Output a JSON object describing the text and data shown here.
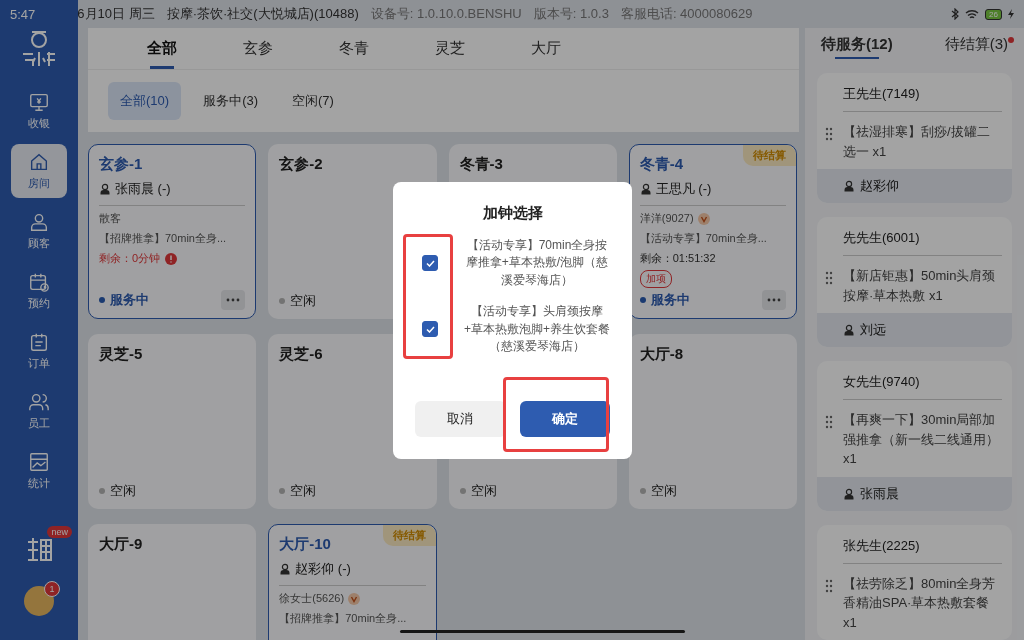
{
  "status_bar": {
    "time": "5:47",
    "date": "6月10日 周三",
    "store": "按摩·茶饮·社交(大悦城店)(10488)",
    "device": "设备号: 1.0.10.0.BENSHU",
    "version": "版本号: 1.0.3",
    "phone": "客服电话: 4000080629",
    "battery": "26"
  },
  "sidebar": {
    "items": [
      {
        "label": "收银",
        "selected": false
      },
      {
        "label": "房间",
        "selected": true
      },
      {
        "label": "顾客",
        "selected": false
      },
      {
        "label": "预约",
        "selected": false
      },
      {
        "label": "订单",
        "selected": false
      },
      {
        "label": "员工",
        "selected": false
      },
      {
        "label": "统计",
        "selected": false
      }
    ],
    "promo_badge": "new",
    "avatar_badge": "1"
  },
  "area_tabs": [
    {
      "label": "全部",
      "selected": true
    },
    {
      "label": "玄参",
      "selected": false
    },
    {
      "label": "冬青",
      "selected": false
    },
    {
      "label": "灵芝",
      "selected": false
    },
    {
      "label": "大厅",
      "selected": false
    }
  ],
  "filters": [
    {
      "label": "全部(10)",
      "selected": true
    },
    {
      "label": "服务中(3)",
      "selected": false
    },
    {
      "label": "空闲(7)",
      "selected": false
    }
  ],
  "rooms": [
    {
      "name": "玄参-1",
      "active": true,
      "staff": "张雨晨 (-)",
      "customer": "散客",
      "vip": false,
      "item": "【招牌推拿】70min全身...",
      "remaining": "剩余：0分钟",
      "overdue": true,
      "status": "服务中",
      "color": "#1b3b71",
      "more": true
    },
    {
      "name": "玄参-2",
      "active": false,
      "status": "空闲",
      "color": "#737373",
      "more": false
    },
    {
      "name": "冬青-3",
      "active": false,
      "more": false
    },
    {
      "name": "冬青-4",
      "active": true,
      "badge": "待结算",
      "staff": "王思凡 (-)",
      "customer": "洋洋(9027)",
      "vip": true,
      "item": "【活动专享】70min全身...",
      "remaining": "剩余：01:51:32",
      "overdue": false,
      "tag": "加项",
      "status": "服务中",
      "color": "#1b3b71",
      "more": true
    },
    {
      "name": "灵芝-5",
      "active": false,
      "status": "空闲",
      "color": "#737373",
      "more": false
    },
    {
      "name": "灵芝-6",
      "active": false,
      "status": "空闲",
      "color": "#737373",
      "more": false
    },
    {
      "active": false,
      "status": "空闲",
      "color": "#737373",
      "more": false
    },
    {
      "name": "大厅-8",
      "active": false,
      "status": "空闲",
      "color": "#737373",
      "more": false
    },
    {
      "name": "大厅-9",
      "active": false,
      "more": false
    },
    {
      "name": "大厅-10",
      "active": true,
      "badge": "待结算",
      "staff": "赵彩仰 (-)",
      "customer": "徐女士(5626)",
      "vip": true,
      "item": "【招牌推拿】70min全身...",
      "more": false
    }
  ],
  "queue": {
    "tabs": [
      {
        "label": "待服务(12)",
        "selected": true,
        "dot": false
      },
      {
        "label": "待结算(3)",
        "selected": false,
        "dot": true
      }
    ],
    "orders": [
      {
        "customer": "王先生(7149)",
        "item": "【祛湿排寒】刮痧/拔罐二选一 x1",
        "staff": "赵彩仰"
      },
      {
        "customer": "先先生(6001)",
        "item": "【新店钜惠】50min头肩颈按摩·草本热敷 x1",
        "staff": "刘远"
      },
      {
        "customer": "女先生(9740)",
        "item": "【再爽一下】30min局部加强推拿（新一线二线通用）x1",
        "staff": "张雨晨"
      },
      {
        "customer": "张先生(2225)",
        "item": "【祛劳除乏】80min全身芳香精油SPA·草本热敷套餐 x1"
      }
    ]
  },
  "dialog": {
    "title": "加钟选择",
    "options": [
      {
        "text": "【活动专享】70min全身按摩推拿+草本热敷/泡脚（慈溪爱琴海店）",
        "checked": true
      },
      {
        "text": "【活动专享】头肩颈按摩+草本热敷泡脚+养生饮套餐（慈溪爱琴海店）",
        "checked": true
      }
    ],
    "cancel": "取消",
    "confirm": "确定"
  }
}
